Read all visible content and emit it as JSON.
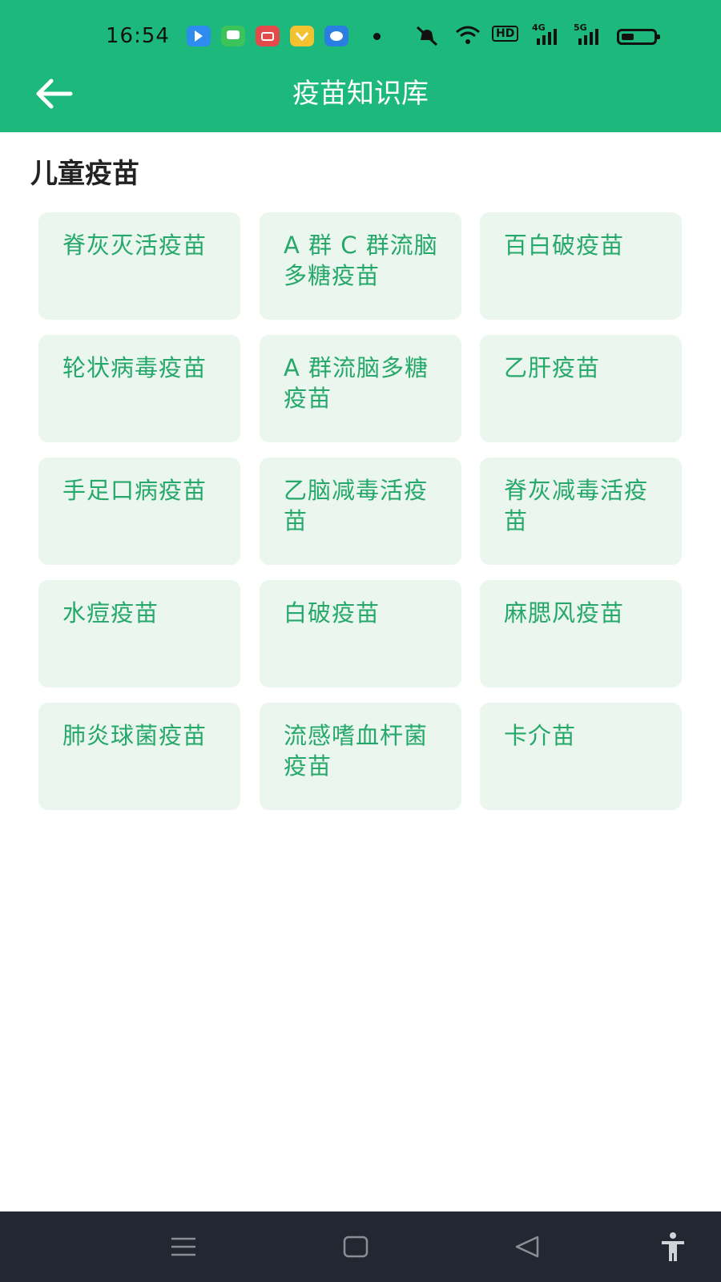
{
  "status_bar": {
    "time": "16:54",
    "notification_icons": [
      {
        "name": "app-icon-blue",
        "color": "#2e8cf0"
      },
      {
        "name": "messages-icon",
        "color": "#3cc35a"
      },
      {
        "name": "store-icon",
        "color": "#e34a4a"
      },
      {
        "name": "wallet-icon",
        "color": "#f2c230"
      },
      {
        "name": "browser-icon",
        "color": "#2a7de1"
      }
    ],
    "hd_label": "HD",
    "net_4g": "4G",
    "net_5g": "5G"
  },
  "header": {
    "title": "疫苗知识库",
    "back_icon": "arrow-left-icon",
    "background_color": "#1db97c"
  },
  "section": {
    "title": "儿童疫苗"
  },
  "vaccines": [
    {
      "label": "脊灰灭活疫苗"
    },
    {
      "label": "A 群 C 群流脑多糖疫苗"
    },
    {
      "label": "百白破疫苗"
    },
    {
      "label": "轮状病毒疫苗"
    },
    {
      "label": "A 群流脑多糖疫苗"
    },
    {
      "label": "乙肝疫苗"
    },
    {
      "label": "手足口病疫苗"
    },
    {
      "label": "乙脑减毒活疫苗"
    },
    {
      "label": "脊灰减毒活疫苗"
    },
    {
      "label": "水痘疫苗"
    },
    {
      "label": "白破疫苗"
    },
    {
      "label": "麻腮风疫苗"
    },
    {
      "label": "肺炎球菌疫苗"
    },
    {
      "label": "流感嗜血杆菌疫苗"
    },
    {
      "label": "卡介苗"
    }
  ],
  "colors": {
    "card_background": "#eaf6ee",
    "card_text": "#27a86b",
    "nav_background": "#222831"
  },
  "nav_bar": {
    "buttons": [
      "menu-icon",
      "home-square-icon",
      "back-triangle-icon",
      "accessibility-icon"
    ]
  }
}
